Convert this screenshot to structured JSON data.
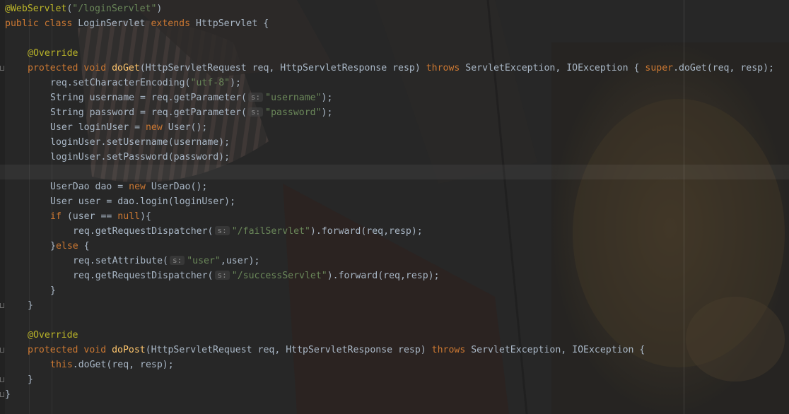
{
  "editor": {
    "lines": [
      {
        "indent": 0,
        "tokens": [
          {
            "t": "@WebServlet",
            "c": "annotation"
          },
          {
            "t": "(",
            "c": "plain"
          },
          {
            "t": "\"/loginServlet\"",
            "c": "string"
          },
          {
            "t": ")",
            "c": "plain"
          }
        ]
      },
      {
        "indent": 0,
        "tokens": [
          {
            "t": "public class ",
            "c": "keyword"
          },
          {
            "t": "LoginServlet ",
            "c": "plain"
          },
          {
            "t": "extends ",
            "c": "keyword"
          },
          {
            "t": "HttpServlet {",
            "c": "plain"
          }
        ]
      },
      {
        "indent": 0,
        "tokens": []
      },
      {
        "indent": 1,
        "tokens": [
          {
            "t": "@Override",
            "c": "annotation"
          }
        ]
      },
      {
        "indent": 1,
        "fold": true,
        "tokens": [
          {
            "t": "protected void ",
            "c": "keyword"
          },
          {
            "t": "doGet",
            "c": "method-decl"
          },
          {
            "t": "(HttpServletRequest req, HttpServletResponse resp) ",
            "c": "plain"
          },
          {
            "t": "throws ",
            "c": "keyword"
          },
          {
            "t": "ServletException, IOException { ",
            "c": "plain"
          },
          {
            "t": "super",
            "c": "keyword"
          },
          {
            "t": ".doGet(req, resp);",
            "c": "plain"
          }
        ]
      },
      {
        "indent": 2,
        "tokens": [
          {
            "t": "req.setCharacterEncoding(",
            "c": "plain"
          },
          {
            "t": "\"utf-8\"",
            "c": "string"
          },
          {
            "t": ");",
            "c": "plain"
          }
        ]
      },
      {
        "indent": 2,
        "tokens": [
          {
            "t": "String username = req.getParameter(",
            "c": "plain"
          },
          {
            "t": "s:",
            "c": "hint"
          },
          {
            "t": "\"username\"",
            "c": "string"
          },
          {
            "t": ");",
            "c": "plain"
          }
        ]
      },
      {
        "indent": 2,
        "tokens": [
          {
            "t": "String password = req.getParameter(",
            "c": "plain"
          },
          {
            "t": "s:",
            "c": "hint"
          },
          {
            "t": "\"password\"",
            "c": "string"
          },
          {
            "t": ");",
            "c": "plain"
          }
        ]
      },
      {
        "indent": 2,
        "tokens": [
          {
            "t": "User loginUser = ",
            "c": "plain"
          },
          {
            "t": "new ",
            "c": "keyword"
          },
          {
            "t": "User();",
            "c": "plain"
          }
        ]
      },
      {
        "indent": 2,
        "tokens": [
          {
            "t": "loginUser.setUsername(username);",
            "c": "plain"
          }
        ]
      },
      {
        "indent": 2,
        "tokens": [
          {
            "t": "loginUser.setPassword(password);",
            "c": "plain"
          }
        ]
      },
      {
        "indent": 0,
        "current": true,
        "tokens": []
      },
      {
        "indent": 2,
        "tokens": [
          {
            "t": "UserDao dao = ",
            "c": "plain"
          },
          {
            "t": "new ",
            "c": "keyword"
          },
          {
            "t": "UserDao();",
            "c": "plain"
          }
        ]
      },
      {
        "indent": 2,
        "tokens": [
          {
            "t": "User user = dao.login(loginUser);",
            "c": "plain"
          }
        ]
      },
      {
        "indent": 2,
        "tokens": [
          {
            "t": "if ",
            "c": "keyword"
          },
          {
            "t": "(user == ",
            "c": "plain"
          },
          {
            "t": "null",
            "c": "keyword"
          },
          {
            "t": "){",
            "c": "plain"
          }
        ]
      },
      {
        "indent": 3,
        "tokens": [
          {
            "t": "req.getRequestDispatcher(",
            "c": "plain"
          },
          {
            "t": "s:",
            "c": "hint"
          },
          {
            "t": "\"/failServlet\"",
            "c": "string"
          },
          {
            "t": ").forward(req,resp);",
            "c": "plain"
          }
        ]
      },
      {
        "indent": 2,
        "tokens": [
          {
            "t": "}",
            "c": "plain"
          },
          {
            "t": "else ",
            "c": "keyword"
          },
          {
            "t": "{",
            "c": "plain"
          }
        ]
      },
      {
        "indent": 3,
        "tokens": [
          {
            "t": "req.setAttribute(",
            "c": "plain"
          },
          {
            "t": "s:",
            "c": "hint"
          },
          {
            "t": "\"user\"",
            "c": "string"
          },
          {
            "t": ",user);",
            "c": "plain"
          }
        ]
      },
      {
        "indent": 3,
        "tokens": [
          {
            "t": "req.getRequestDispatcher(",
            "c": "plain"
          },
          {
            "t": "s:",
            "c": "hint"
          },
          {
            "t": "\"/successServlet\"",
            "c": "string"
          },
          {
            "t": ").forward(req,resp);",
            "c": "plain"
          }
        ]
      },
      {
        "indent": 2,
        "tokens": [
          {
            "t": "}",
            "c": "plain"
          }
        ]
      },
      {
        "indent": 1,
        "fold": true,
        "tokens": [
          {
            "t": "}",
            "c": "plain"
          }
        ]
      },
      {
        "indent": 0,
        "tokens": []
      },
      {
        "indent": 1,
        "tokens": [
          {
            "t": "@Override",
            "c": "annotation"
          }
        ]
      },
      {
        "indent": 1,
        "fold": true,
        "tokens": [
          {
            "t": "protected void ",
            "c": "keyword"
          },
          {
            "t": "doPost",
            "c": "method-decl"
          },
          {
            "t": "(HttpServletRequest req, HttpServletResponse resp) ",
            "c": "plain"
          },
          {
            "t": "throws ",
            "c": "keyword"
          },
          {
            "t": "ServletException, IOException {",
            "c": "plain"
          }
        ]
      },
      {
        "indent": 2,
        "tokens": [
          {
            "t": "this",
            "c": "keyword"
          },
          {
            "t": ".doGet(req, resp);",
            "c": "plain"
          }
        ]
      },
      {
        "indent": 1,
        "fold": true,
        "tokens": [
          {
            "t": "}",
            "c": "plain"
          }
        ]
      },
      {
        "indent": 0,
        "fold": true,
        "tokens": [
          {
            "t": "}",
            "c": "plain"
          }
        ]
      }
    ]
  }
}
